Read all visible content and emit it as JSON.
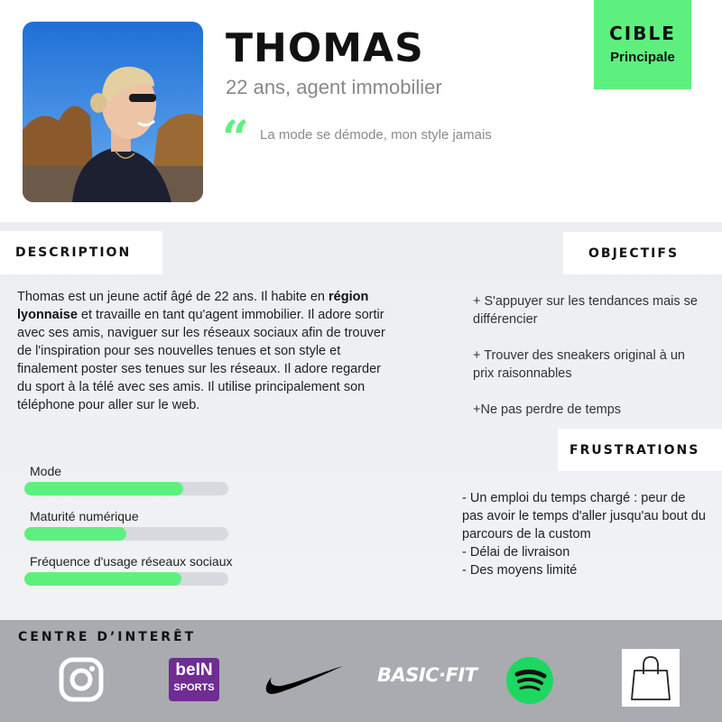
{
  "header": {
    "name": "THOMAS",
    "subtitle": "22 ans, agent immobilier",
    "quote": "La mode se démode, mon style jamais",
    "quote_mark": "“"
  },
  "cible": {
    "title": "CIBLE",
    "subtitle": "Principale"
  },
  "description": {
    "label": "DESCRIPTION",
    "text_before": "Thomas est un jeune actif âgé de 22 ans. Il habite en ",
    "text_bold": "région lyonnaise",
    "text_after": " et travaille en tant qu'agent immobilier. Il adore sortir avec ses amis, naviguer sur les réseaux sociaux afin de trouver de l'inspiration pour ses nouvelles tenues et son style et finalement poster ses tenues sur les réseaux. Il adore regarder du sport à la télé avec ses amis. Il utilise principalement son téléphone pour aller sur le web."
  },
  "bars": [
    {
      "label": "Mode",
      "level": 0.78
    },
    {
      "label": "Maturité numérique",
      "level": 0.5
    },
    {
      "label": "Fréquence d'usage réseaux sociaux",
      "level": 0.77
    }
  ],
  "objectifs": {
    "label": "OBJECTIFS",
    "items": [
      "+ S'appuyer sur les tendances mais se différencier",
      "+ Trouver des sneakers original à un prix raisonnables",
      "+Ne pas perdre de temps"
    ]
  },
  "frustrations": {
    "label": "FRUSTRATIONS",
    "items": [
      "- Un emploi du temps chargé : peur de pas avoir le temps d'aller jusqu'au bout du parcours de la custom",
      "- Délai de livraison",
      "- Des moyens limité"
    ]
  },
  "interests": {
    "label": "CENTRE  D’INTERÊT",
    "icons": [
      "instagram-icon",
      "bein-sports-icon",
      "nike-icon",
      "basic-fit-icon",
      "spotify-icon",
      "shopping-bag-icon"
    ],
    "bein_logo_top": "beIN",
    "bein_logo_bottom": "SPORTS",
    "basicfit_logo": "BASIC·FIT"
  },
  "colors": {
    "accent": "#5ef07f",
    "panel": "#eceef1",
    "interests_bg": "#a9abb0",
    "bein_purple": "#6f2c91",
    "spotify_green": "#1ed760"
  }
}
